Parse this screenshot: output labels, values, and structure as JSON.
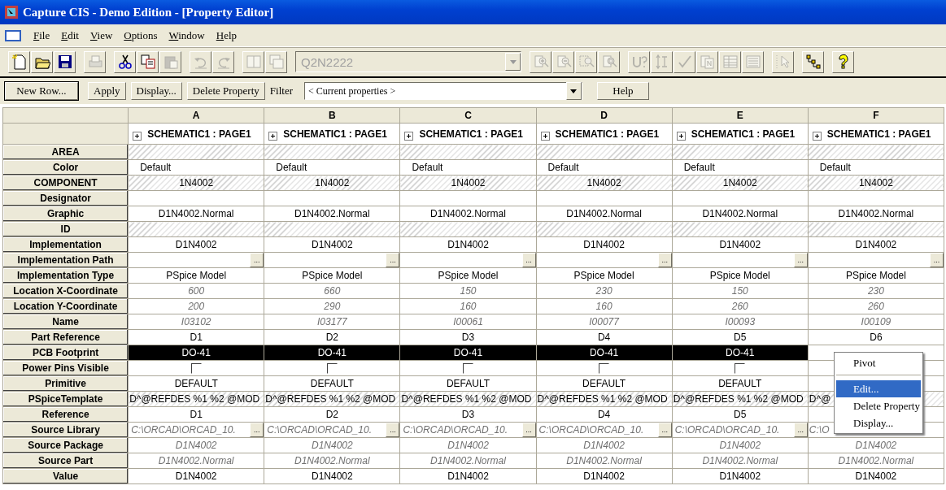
{
  "window": {
    "title": "Capture CIS - Demo Edition - [Property Editor]"
  },
  "menu_bar": [
    {
      "label": "File"
    },
    {
      "label": "Edit"
    },
    {
      "label": "View"
    },
    {
      "label": "Options"
    },
    {
      "label": "Window"
    },
    {
      "label": "Help"
    }
  ],
  "toolbar": [
    {
      "kind": "button",
      "disabled": false
    },
    {
      "kind": "button",
      "disabled": false
    },
    {
      "kind": "button",
      "disabled": false
    },
    {
      "kind": "separator"
    },
    {
      "kind": "button",
      "disabled": true
    },
    {
      "kind": "separator"
    },
    {
      "kind": "button",
      "disabled": false
    },
    {
      "kind": "button",
      "disabled": false
    },
    {
      "kind": "button",
      "disabled": true
    },
    {
      "kind": "separator"
    },
    {
      "kind": "button",
      "disabled": true
    },
    {
      "kind": "button",
      "disabled": true
    },
    {
      "kind": "separator"
    },
    {
      "kind": "button",
      "disabled": true
    },
    {
      "kind": "button",
      "disabled": true
    },
    {
      "kind": "separator"
    },
    {
      "kind": "combo",
      "value": "Q2N2222",
      "disabled": true
    },
    {
      "kind": "separator"
    },
    {
      "kind": "button",
      "disabled": true
    },
    {
      "kind": "button",
      "disabled": true
    },
    {
      "kind": "button",
      "disabled": true
    },
    {
      "kind": "button",
      "disabled": true
    },
    {
      "kind": "separator"
    },
    {
      "kind": "button",
      "disabled": true
    },
    {
      "kind": "button",
      "disabled": true
    },
    {
      "kind": "button",
      "disabled": true
    },
    {
      "kind": "button",
      "disabled": true
    },
    {
      "kind": "button",
      "disabled": true
    },
    {
      "kind": "button",
      "disabled": true
    },
    {
      "kind": "separator"
    },
    {
      "kind": "button",
      "disabled": true
    },
    {
      "kind": "separator"
    },
    {
      "kind": "button",
      "disabled": false
    },
    {
      "kind": "separator"
    },
    {
      "kind": "button",
      "disabled": false
    }
  ],
  "button_bar": {
    "buttons": [
      {
        "label": "New Row...",
        "default": true
      },
      {
        "label": "Apply",
        "default": false
      },
      {
        "label": "Display...",
        "default": false
      },
      {
        "label": "Delete Property",
        "default": false
      }
    ],
    "filter": {
      "label": "Filter",
      "value": "< Current properties >"
    },
    "help_button": {
      "label": "Help"
    }
  },
  "columns": [
    {
      "letter": "A",
      "source": "SCHEMATIC1 : PAGE1",
      "expanded": false
    },
    {
      "letter": "B",
      "source": "SCHEMATIC1 : PAGE1",
      "expanded": false
    },
    {
      "letter": "C",
      "source": "SCHEMATIC1 : PAGE1",
      "expanded": false
    },
    {
      "letter": "D",
      "source": "SCHEMATIC1 : PAGE1",
      "expanded": false
    },
    {
      "letter": "E",
      "source": "SCHEMATIC1 : PAGE1",
      "expanded": false
    },
    {
      "letter": "F",
      "source": "SCHEMATIC1 : PAGE1",
      "expanded": false
    }
  ],
  "rows": [
    {
      "name": "AREA",
      "kind": "hatched",
      "cells": [
        {
          "selected": false
        },
        {
          "selected": false
        },
        {
          "selected": false
        },
        {
          "selected": false
        },
        {
          "selected": false
        },
        {
          "selected": false
        }
      ]
    },
    {
      "name": "Color",
      "kind": "text",
      "align_left": true,
      "cells": [
        {
          "text": "Default",
          "selected": false
        },
        {
          "text": "Default",
          "selected": false
        },
        {
          "text": "Default",
          "selected": false
        },
        {
          "text": "Default",
          "selected": false
        },
        {
          "text": "Default",
          "selected": false
        },
        {
          "text": "Default",
          "selected": false
        }
      ]
    },
    {
      "name": "COMPONENT",
      "kind": "hatched",
      "cells": [
        {
          "text": "1N4002",
          "selected": false
        },
        {
          "text": "1N4002",
          "selected": false
        },
        {
          "text": "1N4002",
          "selected": false
        },
        {
          "text": "1N4002",
          "selected": false
        },
        {
          "text": "1N4002",
          "selected": false
        },
        {
          "text": "1N4002",
          "selected": false
        }
      ]
    },
    {
      "name": "Designator",
      "kind": "text",
      "cells": [
        {
          "selected": false
        },
        {
          "selected": false
        },
        {
          "selected": false
        },
        {
          "selected": false
        },
        {
          "selected": false
        },
        {
          "selected": false
        }
      ]
    },
    {
      "name": "Graphic",
      "kind": "text",
      "cells": [
        {
          "text": "D1N4002.Normal",
          "selected": false
        },
        {
          "text": "D1N4002.Normal",
          "selected": false
        },
        {
          "text": "D1N4002.Normal",
          "selected": false
        },
        {
          "text": "D1N4002.Normal",
          "selected": false
        },
        {
          "text": "D1N4002.Normal",
          "selected": false
        },
        {
          "text": "D1N4002.Normal",
          "selected": false
        }
      ]
    },
    {
      "name": "ID",
      "kind": "hatched",
      "cells": [
        {
          "selected": false
        },
        {
          "selected": false
        },
        {
          "selected": false
        },
        {
          "selected": false
        },
        {
          "selected": false
        },
        {
          "selected": false
        }
      ]
    },
    {
      "name": "Implementation",
      "kind": "text",
      "cells": [
        {
          "text": "D1N4002",
          "selected": false
        },
        {
          "text": "D1N4002",
          "selected": false
        },
        {
          "text": "D1N4002",
          "selected": false
        },
        {
          "text": "D1N4002",
          "selected": false
        },
        {
          "text": "D1N4002",
          "selected": false
        },
        {
          "text": "D1N4002",
          "selected": false
        }
      ]
    },
    {
      "name": "Implementation Path",
      "kind": "text",
      "cells": [
        {
          "button": "...",
          "selected": false
        },
        {
          "button": "...",
          "selected": false
        },
        {
          "button": "...",
          "selected": false
        },
        {
          "button": "...",
          "selected": false
        },
        {
          "button": "...",
          "selected": false
        },
        {
          "button": "...",
          "selected": false
        }
      ]
    },
    {
      "name": "Implementation Type",
      "kind": "text",
      "cells": [
        {
          "text": "PSpice Model",
          "selected": false
        },
        {
          "text": "PSpice Model",
          "selected": false
        },
        {
          "text": "PSpice Model",
          "selected": false
        },
        {
          "text": "PSpice Model",
          "selected": false
        },
        {
          "text": "PSpice Model",
          "selected": false
        },
        {
          "text": "PSpice Model",
          "selected": false
        }
      ]
    },
    {
      "name": "Location X-Coordinate",
      "kind": "readonly",
      "cells": [
        {
          "text": "600",
          "selected": false
        },
        {
          "text": "660",
          "selected": false
        },
        {
          "text": "150",
          "selected": false
        },
        {
          "text": "230",
          "selected": false
        },
        {
          "text": "150",
          "selected": false
        },
        {
          "text": "230",
          "selected": false
        }
      ]
    },
    {
      "name": "Location Y-Coordinate",
      "kind": "readonly",
      "cells": [
        {
          "text": "200",
          "selected": false
        },
        {
          "text": "290",
          "selected": false
        },
        {
          "text": "160",
          "selected": false
        },
        {
          "text": "160",
          "selected": false
        },
        {
          "text": "260",
          "selected": false
        },
        {
          "text": "260",
          "selected": false
        }
      ]
    },
    {
      "name": "Name",
      "kind": "readonly",
      "cells": [
        {
          "text": "I03102",
          "selected": false
        },
        {
          "text": "I03177",
          "selected": false
        },
        {
          "text": "I00061",
          "selected": false
        },
        {
          "text": "I00077",
          "selected": false
        },
        {
          "text": "I00093",
          "selected": false
        },
        {
          "text": "I00109",
          "selected": false
        }
      ]
    },
    {
      "name": "Part Reference",
      "kind": "text",
      "cells": [
        {
          "text": "D1",
          "selected": false
        },
        {
          "text": "D2",
          "selected": false
        },
        {
          "text": "D3",
          "selected": false
        },
        {
          "text": "D4",
          "selected": false
        },
        {
          "text": "D5",
          "selected": false
        },
        {
          "text": "D6",
          "selected": false
        }
      ]
    },
    {
      "name": "PCB Footprint",
      "kind": "text",
      "cells": [
        {
          "text": "DO-41",
          "selected": true
        },
        {
          "text": "DO-41",
          "selected": true
        },
        {
          "text": "DO-41",
          "selected": true
        },
        {
          "text": "DO-41",
          "selected": true
        },
        {
          "text": "DO-41",
          "selected": true
        },
        {
          "selected": false
        }
      ]
    },
    {
      "name": "Power Pins Visible",
      "kind": "checkbox",
      "cells": [
        {
          "checked": false,
          "selected": false
        },
        {
          "checked": false,
          "selected": false
        },
        {
          "checked": false,
          "selected": false
        },
        {
          "checked": false,
          "selected": false
        },
        {
          "checked": false,
          "selected": false
        },
        {
          "selected": false
        }
      ]
    },
    {
      "name": "Primitive",
      "kind": "text",
      "cells": [
        {
          "text": "DEFAULT",
          "selected": false
        },
        {
          "text": "DEFAULT",
          "selected": false
        },
        {
          "text": "DEFAULT",
          "selected": false
        },
        {
          "text": "DEFAULT",
          "selected": false
        },
        {
          "text": "DEFAULT",
          "selected": false
        },
        {
          "selected": false
        }
      ]
    },
    {
      "name": "PSpiceTemplate",
      "kind": "hatched",
      "align_left": true,
      "cells": [
        {
          "text": "D^@REFDES %1 %2 @MOD",
          "selected": false
        },
        {
          "text": "D^@REFDES %1 %2 @MOD",
          "selected": false
        },
        {
          "text": "D^@REFDES %1 %2 @MOD",
          "selected": false
        },
        {
          "text": "D^@REFDES %1 %2 @MOD",
          "selected": false
        },
        {
          "text": "D^@REFDES %1 %2 @MOD",
          "selected": false
        },
        {
          "text": "D^@",
          "selected": false
        }
      ]
    },
    {
      "name": "Reference",
      "kind": "text",
      "cells": [
        {
          "text": "D1",
          "selected": false
        },
        {
          "text": "D2",
          "selected": false
        },
        {
          "text": "D3",
          "selected": false
        },
        {
          "text": "D4",
          "selected": false
        },
        {
          "text": "D5",
          "selected": false
        },
        {
          "selected": false
        }
      ]
    },
    {
      "name": "Source Library",
      "kind": "readonly",
      "align_left": true,
      "cells": [
        {
          "text": "C:\\ORCAD\\ORCAD_10.",
          "button": "...",
          "selected": false
        },
        {
          "text": "C:\\ORCAD\\ORCAD_10.",
          "button": "...",
          "selected": false
        },
        {
          "text": "C:\\ORCAD\\ORCAD_10.",
          "button": "...",
          "selected": false
        },
        {
          "text": "C:\\ORCAD\\ORCAD_10.",
          "button": "...",
          "selected": false
        },
        {
          "text": "C:\\ORCAD\\ORCAD_10.",
          "button": "...",
          "selected": false
        },
        {
          "text": "C:\\O",
          "selected": false
        }
      ]
    },
    {
      "name": "Source Package",
      "kind": "readonly",
      "cells": [
        {
          "text": "D1N4002",
          "selected": false
        },
        {
          "text": "D1N4002",
          "selected": false
        },
        {
          "text": "D1N4002",
          "selected": false
        },
        {
          "text": "D1N4002",
          "selected": false
        },
        {
          "text": "D1N4002",
          "selected": false
        },
        {
          "text": "D1N4002",
          "selected": false
        }
      ]
    },
    {
      "name": "Source Part",
      "kind": "readonly",
      "cells": [
        {
          "text": "D1N4002.Normal",
          "selected": false
        },
        {
          "text": "D1N4002.Normal",
          "selected": false
        },
        {
          "text": "D1N4002.Normal",
          "selected": false
        },
        {
          "text": "D1N4002.Normal",
          "selected": false
        },
        {
          "text": "D1N4002.Normal",
          "selected": false
        },
        {
          "text": "D1N4002.Normal",
          "selected": false
        }
      ]
    },
    {
      "name": "Value",
      "kind": "text",
      "cells": [
        {
          "text": "D1N4002",
          "selected": false
        },
        {
          "text": "D1N4002",
          "selected": false
        },
        {
          "text": "D1N4002",
          "selected": false
        },
        {
          "text": "D1N4002",
          "selected": false
        },
        {
          "text": "D1N4002",
          "selected": false
        },
        {
          "text": "D1N4002",
          "selected": false
        }
      ]
    }
  ],
  "context_menu": [
    {
      "kind": "item",
      "label": "Pivot",
      "selected": false
    },
    {
      "kind": "separator"
    },
    {
      "kind": "item",
      "label": "Edit...",
      "selected": true
    },
    {
      "kind": "item",
      "label": "Delete Property",
      "selected": false
    },
    {
      "kind": "item",
      "label": "Display...",
      "selected": false
    }
  ]
}
